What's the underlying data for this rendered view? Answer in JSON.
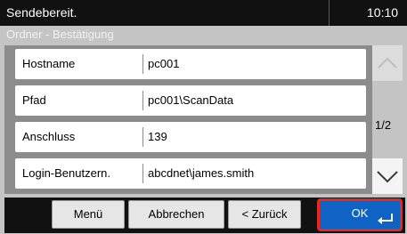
{
  "status": {
    "message": "Sendebereit.",
    "time": "10:10"
  },
  "screen": {
    "title": "Ordner - Bestätigung"
  },
  "rows": [
    {
      "label": "Hostname",
      "value": "pc001"
    },
    {
      "label": "Pfad",
      "value": "pc001\\ScanData"
    },
    {
      "label": "Anschluss",
      "value": "139"
    },
    {
      "label": "Login-Benutzern.",
      "value": "abcdnet\\james.smith"
    }
  ],
  "pagination": {
    "page": "1/2"
  },
  "buttons": {
    "menu": "Menü",
    "cancel": "Abbrechen",
    "back": "< Zurück",
    "ok": "OK"
  },
  "colors": {
    "ok": "#0f63c4",
    "highlight": "#e8281e",
    "statusbar": "#111111",
    "screen": "#c4c4c4"
  },
  "icons": {
    "up": "chevron-up-icon",
    "down": "chevron-down-icon",
    "enter": "enter-icon"
  }
}
